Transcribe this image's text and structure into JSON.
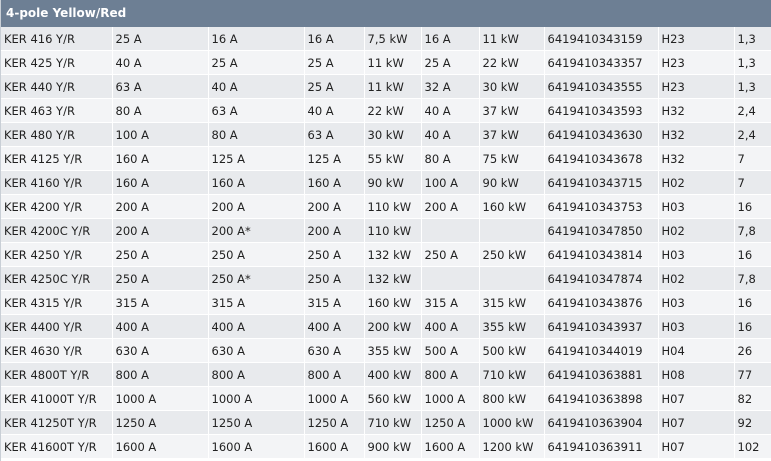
{
  "header": {
    "title": "4-pole Yellow/Red"
  },
  "table": {
    "rows": [
      [
        "KER 416 Y/R",
        "25 A",
        "16 A",
        "16 A",
        "7,5 kW",
        "16 A",
        "11 kW",
        "6419410343159",
        "H23",
        "1,3"
      ],
      [
        "KER 425 Y/R",
        "40 A",
        "25 A",
        "25 A",
        "11 kW",
        "25 A",
        "22 kW",
        "6419410343357",
        "H23",
        "1,3"
      ],
      [
        "KER 440 Y/R",
        "63 A",
        "40 A",
        "25 A",
        "11 kW",
        "32 A",
        "30 kW",
        "6419410343555",
        "H23",
        "1,3"
      ],
      [
        "KER 463 Y/R",
        "80 A",
        "63 A",
        "40 A",
        "22 kW",
        "40 A",
        "37 kW",
        "6419410343593",
        "H32",
        "2,4"
      ],
      [
        "KER 480 Y/R",
        "100 A",
        "80 A",
        "63 A",
        "30 kW",
        "40 A",
        "37 kW",
        "6419410343630",
        "H32",
        "2,4"
      ],
      [
        "KER 4125 Y/R",
        "160 A",
        "125 A",
        "125 A",
        "55 kW",
        "80 A",
        "75 kW",
        "6419410343678",
        "H32",
        "7"
      ],
      [
        "KER 4160 Y/R",
        "160 A",
        "160 A",
        "160 A",
        "90 kW",
        "100 A",
        "90 kW",
        "6419410343715",
        "H02",
        "7"
      ],
      [
        "KER 4200 Y/R",
        "200 A",
        "200 A",
        "200 A",
        "110 kW",
        "200 A",
        "160 kW",
        "6419410343753",
        "H03",
        "16"
      ],
      [
        "KER 4200C Y/R",
        "200 A",
        "200 A*",
        "200 A",
        "110 kW",
        "",
        "",
        "6419410347850",
        "H02",
        "7,8"
      ],
      [
        "KER 4250 Y/R",
        "250 A",
        "250 A",
        "250 A",
        "132 kW",
        "250 A",
        "250 kW",
        "6419410343814",
        "H03",
        "16"
      ],
      [
        "KER 4250C Y/R",
        "250 A",
        "250 A*",
        "250 A",
        "132 kW",
        "",
        "",
        "6419410347874",
        "H02",
        "7,8"
      ],
      [
        "KER 4315 Y/R",
        "315 A",
        "315 A",
        "315 A",
        "160 kW",
        "315 A",
        "315 kW",
        "6419410343876",
        "H03",
        "16"
      ],
      [
        "KER 4400 Y/R",
        "400 A",
        "400 A",
        "400 A",
        "200 kW",
        "400 A",
        "355 kW",
        "6419410343937",
        "H03",
        "16"
      ],
      [
        "KER 4630 Y/R",
        "630 A",
        "630 A",
        "630 A",
        "355 kW",
        "500 A",
        "500 kW",
        "6419410344019",
        "H04",
        "26"
      ],
      [
        "KER 4800T Y/R",
        "800 A",
        "800 A",
        "800 A",
        "400 kW",
        "800 A",
        "710 kW",
        "6419410363881",
        "H08",
        "77"
      ],
      [
        "KER 41000T Y/R",
        "1000 A",
        "1000 A",
        "1000 A",
        "560 kW",
        "1000 A",
        "800 kW",
        "6419410363898",
        "H07",
        "82"
      ],
      [
        "KER 41250T Y/R",
        "1250 A",
        "1250 A",
        "1250 A",
        "710 kW",
        "1250 A",
        "1000 kW",
        "6419410363904",
        "H07",
        "92"
      ],
      [
        "KER 41600T Y/R",
        "1600 A",
        "1600 A",
        "1600 A",
        "900 kW",
        "1600 A",
        "1200 kW",
        "6419410363911",
        "H07",
        "102"
      ]
    ]
  }
}
